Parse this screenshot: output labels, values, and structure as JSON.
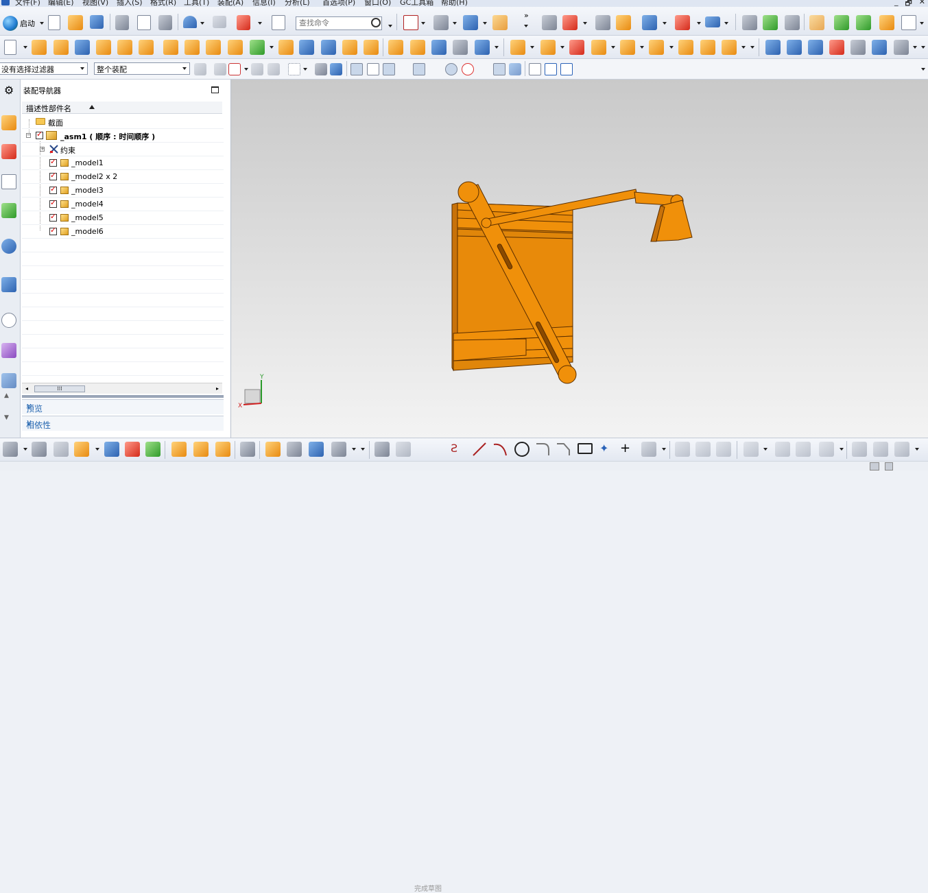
{
  "menubar": {
    "items": [
      "文件(F)",
      "编辑(E)",
      "视图(V)",
      "插入(S)",
      "格式(R)",
      "工具(T)",
      "装配(A)",
      "信息(I)",
      "分析(L)",
      "首选项(P)",
      "窗口(O)",
      "GC工具箱",
      "帮助(H)"
    ],
    "window_controls": [
      "_",
      "🗗",
      "✕"
    ]
  },
  "toolbar": {
    "start_label": "启动",
    "command_search_placeholder": "查找命令",
    "selection_filter": "没有选择过滤器",
    "assembly_scope": "整个装配"
  },
  "navigator": {
    "title": "装配导航器",
    "column_header": "描述性部件名",
    "rows": [
      {
        "label": "截面",
        "type": "folder"
      },
      {
        "label": "_asm1 ( 顺序 : 时间顺序 )",
        "type": "assembly"
      },
      {
        "label": "约束",
        "type": "constraints"
      },
      {
        "label": "_model1",
        "type": "part"
      },
      {
        "label": "_model2 x 2",
        "type": "part"
      },
      {
        "label": "_model3",
        "type": "part"
      },
      {
        "label": "_model4",
        "type": "part"
      },
      {
        "label": "_model5",
        "type": "part"
      },
      {
        "label": "_model6",
        "type": "part"
      }
    ],
    "panels": [
      "预览",
      "相依性"
    ]
  },
  "viewport": {
    "part_color": "#f0900a",
    "edge_color": "#5a2e00",
    "triad_labels": {
      "x": "X",
      "y": "Y"
    }
  },
  "bottom_toolbar": {
    "finish_sketch_label": "完成草图"
  },
  "icons": [
    "start-globe-icon",
    "new-file-icon",
    "open-folder-icon",
    "save-icon",
    "cut-icon",
    "copy-icon",
    "paste-icon",
    "undo-icon",
    "redo-icon",
    "search-icon",
    "filter-icon",
    "gear-icon"
  ],
  "colors": {
    "accent_blue": "#2466b0",
    "check_red": "#d00000"
  }
}
